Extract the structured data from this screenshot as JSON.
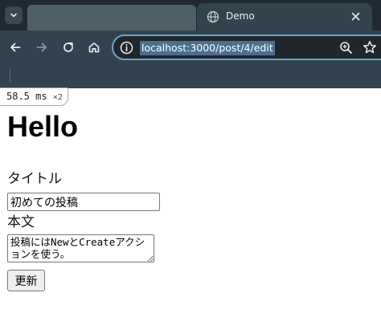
{
  "browser": {
    "tab_title": "Demo",
    "url": "localhost:3000/post/4/edit",
    "icons": {
      "tab_menu": "chevron-down-icon",
      "favicon": "globe-icon",
      "tab_close": "close-icon",
      "back": "arrow-left-icon",
      "forward": "arrow-right-icon",
      "reload": "reload-icon",
      "home": "home-icon",
      "site_info": "info-icon",
      "zoom": "zoom-icon",
      "bookmark": "star-icon"
    },
    "colors": {
      "tabstrip": "#202a30",
      "toolbar": "#33434d",
      "omnibox_border": "#6fa3c9",
      "url_highlight": "#4a6f8f"
    }
  },
  "perf": {
    "time_value": "58.5",
    "time_unit": "ms",
    "multiplier": "×2"
  },
  "page": {
    "heading": "Hello",
    "title_label": "タイトル",
    "title_value": "初めての投稿",
    "body_label": "本文",
    "body_value": "投稿にはNewとCreateアクションを使う。",
    "submit_label": "更新"
  }
}
